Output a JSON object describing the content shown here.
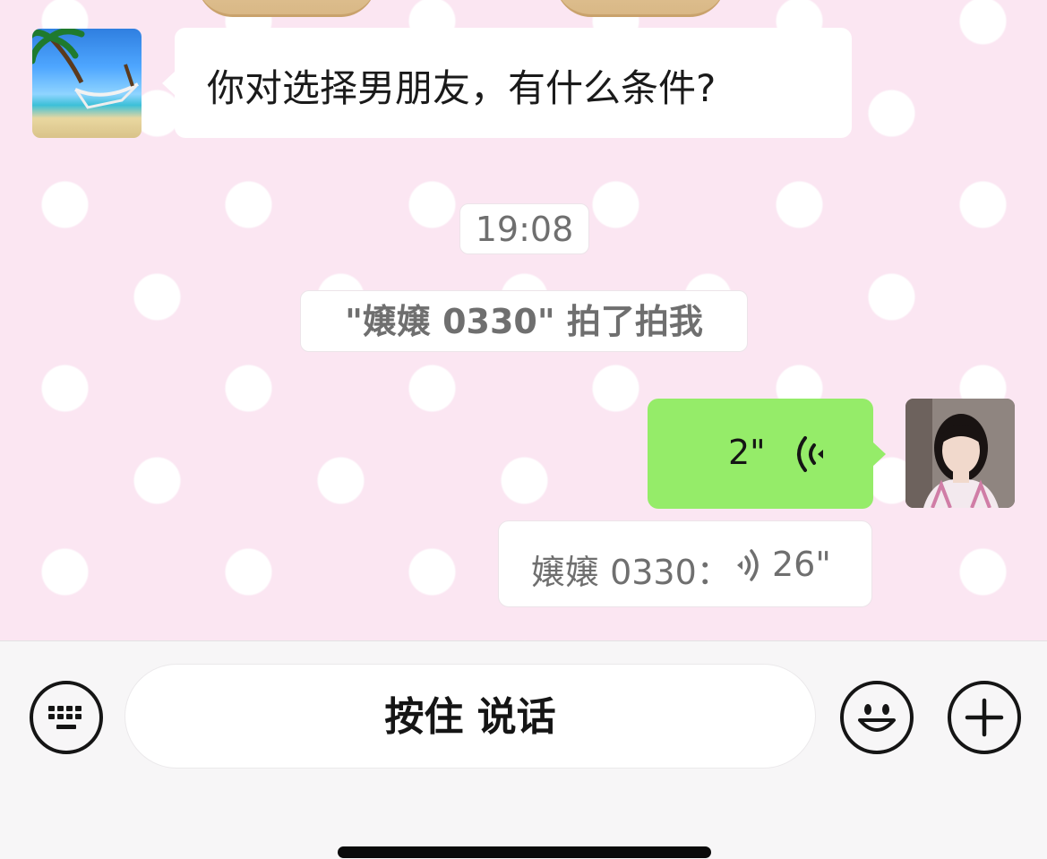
{
  "colors": {
    "wallpaper": "#fbe6f2",
    "dot": "#ffffff",
    "outgoing_bubble": "#95ec69",
    "incoming_bubble": "#ffffff",
    "system_text": "#6f6f6f"
  },
  "messages": {
    "incoming_text": "你对选择男朋友，有什么条件?",
    "timestamp": "19:08",
    "pat_notice": "\"嬢嬢 0330\" 拍了拍我",
    "outgoing_voice_duration": "2\"",
    "transcript_sender": "嬢嬢 0330：",
    "transcript_duration": "26\""
  },
  "input_bar": {
    "hold_to_talk_label": "按住 说话",
    "keyboard_icon": "keyboard-icon",
    "emoji_icon": "smiley-icon",
    "plus_icon": "plus-icon"
  }
}
